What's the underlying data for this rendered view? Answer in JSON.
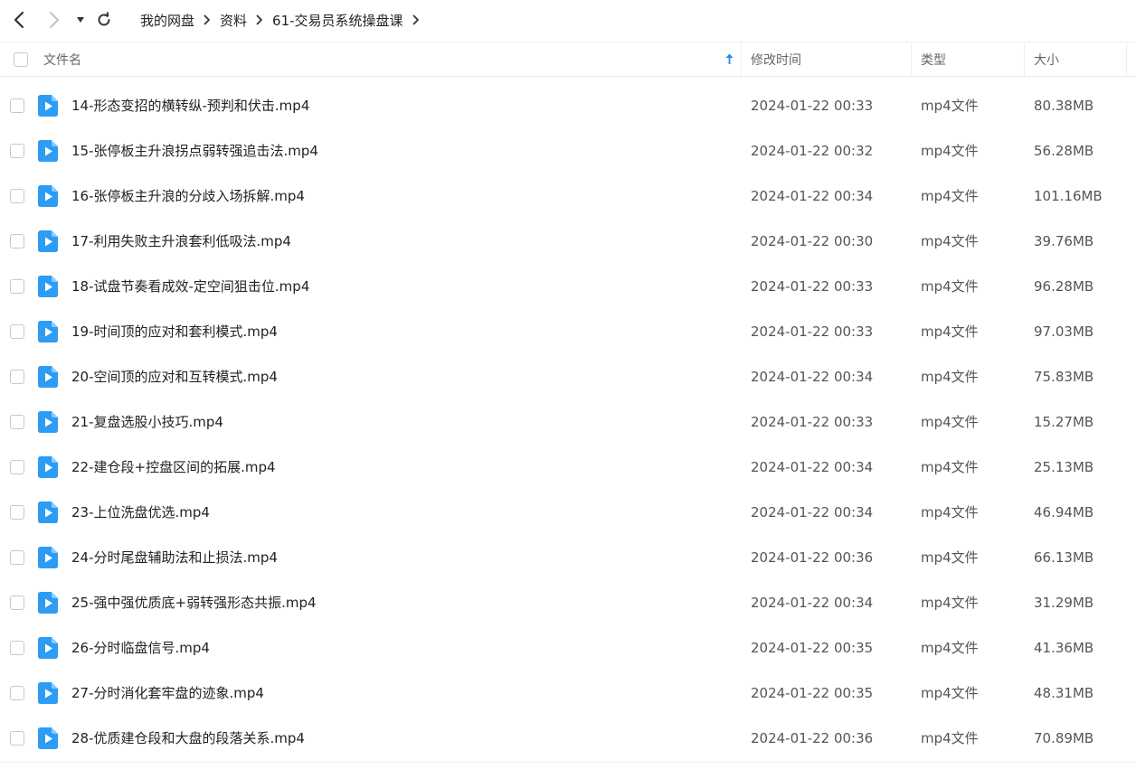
{
  "breadcrumb": [
    "我的网盘",
    "资料",
    "61-交易员系统操盘课"
  ],
  "columns": {
    "name": "文件名",
    "modified": "修改时间",
    "type": "类型",
    "size": "大小"
  },
  "colors": {
    "accent": "#1e8cf0",
    "file_icon": "#2c9cf5",
    "text": "#333333",
    "muted": "#666666",
    "divider": "#eeeeee"
  },
  "icons": {
    "back": "chevron-left-icon",
    "forward": "chevron-right-icon",
    "history": "caret-down-icon",
    "refresh": "refresh-icon",
    "breadcrumb_sep": "chevron-right-icon",
    "sort": "arrow-up-icon",
    "file": "video-file-icon"
  },
  "files": [
    {
      "name": "14-形态变招的横转纵-预判和伏击.mp4",
      "modified": "2024-01-22 00:33",
      "type": "mp4文件",
      "size": "80.38MB"
    },
    {
      "name": "15-张停板主升浪拐点弱转强追击法.mp4",
      "modified": "2024-01-22 00:32",
      "type": "mp4文件",
      "size": "56.28MB"
    },
    {
      "name": "16-张停板主升浪的分歧入场拆解.mp4",
      "modified": "2024-01-22 00:34",
      "type": "mp4文件",
      "size": "101.16MB"
    },
    {
      "name": "17-利用失败主升浪套利低吸法.mp4",
      "modified": "2024-01-22 00:30",
      "type": "mp4文件",
      "size": "39.76MB"
    },
    {
      "name": "18-试盘节奏看成效-定空间狙击位.mp4",
      "modified": "2024-01-22 00:33",
      "type": "mp4文件",
      "size": "96.28MB"
    },
    {
      "name": "19-时间顶的应对和套利模式.mp4",
      "modified": "2024-01-22 00:33",
      "type": "mp4文件",
      "size": "97.03MB"
    },
    {
      "name": "20-空间顶的应对和互转模式.mp4",
      "modified": "2024-01-22 00:34",
      "type": "mp4文件",
      "size": "75.83MB"
    },
    {
      "name": "21-复盘选股小技巧.mp4",
      "modified": "2024-01-22 00:33",
      "type": "mp4文件",
      "size": "15.27MB"
    },
    {
      "name": "22-建仓段+控盘区间的拓展.mp4",
      "modified": "2024-01-22 00:34",
      "type": "mp4文件",
      "size": "25.13MB"
    },
    {
      "name": "23-上位洗盘优选.mp4",
      "modified": "2024-01-22 00:34",
      "type": "mp4文件",
      "size": "46.94MB"
    },
    {
      "name": "24-分时尾盘辅助法和止损法.mp4",
      "modified": "2024-01-22 00:36",
      "type": "mp4文件",
      "size": "66.13MB"
    },
    {
      "name": "25-强中强优质底+弱转强形态共振.mp4",
      "modified": "2024-01-22 00:34",
      "type": "mp4文件",
      "size": "31.29MB"
    },
    {
      "name": "26-分时临盘信号.mp4",
      "modified": "2024-01-22 00:35",
      "type": "mp4文件",
      "size": "41.36MB"
    },
    {
      "name": "27-分时消化套牢盘的迹象.mp4",
      "modified": "2024-01-22 00:35",
      "type": "mp4文件",
      "size": "48.31MB"
    },
    {
      "name": "28-优质建仓段和大盘的段落关系.mp4",
      "modified": "2024-01-22 00:36",
      "type": "mp4文件",
      "size": "70.89MB"
    }
  ]
}
